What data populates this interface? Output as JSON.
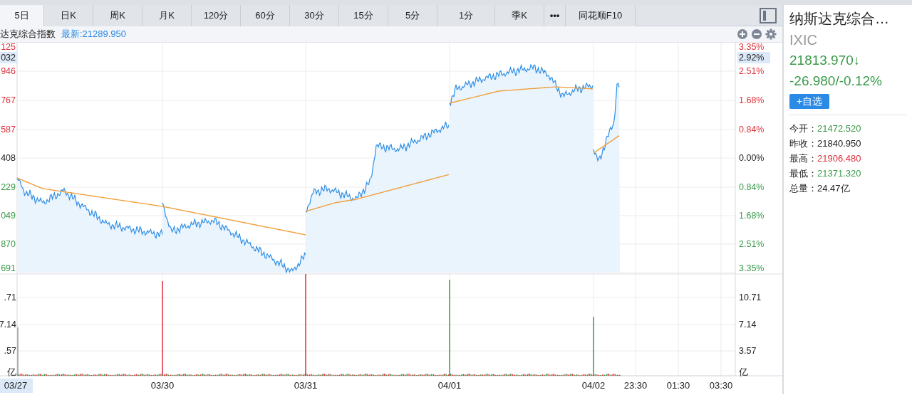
{
  "tabs": [
    {
      "label": "5日",
      "selected": true
    },
    {
      "label": "日K",
      "selected": false
    },
    {
      "label": "周K",
      "selected": false
    },
    {
      "label": "月K",
      "selected": false
    },
    {
      "label": "120分",
      "selected": false
    },
    {
      "label": "60分",
      "selected": false
    },
    {
      "label": "30分",
      "selected": false
    },
    {
      "label": "15分",
      "selected": false
    },
    {
      "label": "5分",
      "selected": false
    },
    {
      "label": "1分",
      "selected": false
    },
    {
      "label": "季K",
      "selected": false
    },
    {
      "label": "•••",
      "selected": false
    },
    {
      "label": "同花顺F10",
      "selected": false
    }
  ],
  "info_bar": {
    "name": "达克综合指数",
    "latest": "最新:21289.950"
  },
  "chart": {
    "left_price_ticks": [
      {
        "label": "125",
        "color": "#e0323c",
        "highlighted": false
      },
      {
        "label": "032",
        "color": "#222222",
        "highlighted": true
      },
      {
        "label": "946",
        "color": "#e0323c",
        "highlighted": false
      },
      {
        "label": "767",
        "color": "#e0323c",
        "highlighted": false
      },
      {
        "label": "587",
        "color": "#e0323c",
        "highlighted": false
      },
      {
        "label": "408",
        "color": "#222222",
        "highlighted": false
      },
      {
        "label": "229",
        "color": "#3a9a4a",
        "highlighted": false
      },
      {
        "label": "049",
        "color": "#3a9a4a",
        "highlighted": false
      },
      {
        "label": "870",
        "color": "#3a9a4a",
        "highlighted": false
      },
      {
        "label": "691",
        "color": "#3a9a4a",
        "highlighted": false
      }
    ],
    "right_price_ticks": [
      {
        "label": "3.35%",
        "color": "#e0323c",
        "highlighted": false
      },
      {
        "label": "2.92%",
        "color": "#222222",
        "highlighted": true
      },
      {
        "label": "2.51%",
        "color": "#e0323c",
        "highlighted": false
      },
      {
        "label": "1.68%",
        "color": "#e0323c",
        "highlighted": false
      },
      {
        "label": "0.84%",
        "color": "#e0323c",
        "highlighted": false
      },
      {
        "label": "0.00%",
        "color": "#222222",
        "highlighted": false
      },
      {
        "label": "0.84%",
        "color": "#3a9a4a",
        "highlighted": false
      },
      {
        "label": "1.68%",
        "color": "#3a9a4a",
        "highlighted": false
      },
      {
        "label": "2.51%",
        "color": "#3a9a4a",
        "highlighted": false
      },
      {
        "label": "3.35%",
        "color": "#3a9a4a",
        "highlighted": false
      }
    ],
    "left_volume_ticks": [
      ".71",
      "7.14",
      ".57",
      "亿"
    ],
    "right_volume_ticks": [
      "10.71",
      "7.14",
      "3.57",
      "亿"
    ],
    "x_labels": [
      {
        "label": "03/27",
        "highlighted": true
      },
      {
        "label": "03/30",
        "highlighted": false
      },
      {
        "label": "03/31",
        "highlighted": false
      },
      {
        "label": "04/01",
        "highlighted": false
      },
      {
        "label": "04/02",
        "highlighted": false
      },
      {
        "label": "23:30",
        "highlighted": false
      },
      {
        "label": "01:30",
        "highlighted": false
      },
      {
        "label": "03:30",
        "highlighted": false
      }
    ]
  },
  "sidebar": {
    "title": "纳斯达克综合…",
    "code": "IXIC",
    "price": {
      "text": "21813.970↓",
      "color": "#3a9a4a"
    },
    "change": {
      "text": "-26.980/-0.12%",
      "color": "#3a9a4a"
    },
    "add_button": "+自选",
    "stats": [
      {
        "label": "今开：",
        "value": "21472.520",
        "color": "#3a9a4a"
      },
      {
        "label": "昨收：",
        "value": "21840.950",
        "color": "#222222"
      },
      {
        "label": "最高：",
        "value": "21906.480",
        "color": "#e0323c"
      },
      {
        "label": "最低：",
        "value": "21371.320",
        "color": "#3a9a4a"
      },
      {
        "label": "总量：",
        "value": "24.47亿",
        "color": "#222222"
      }
    ]
  }
}
